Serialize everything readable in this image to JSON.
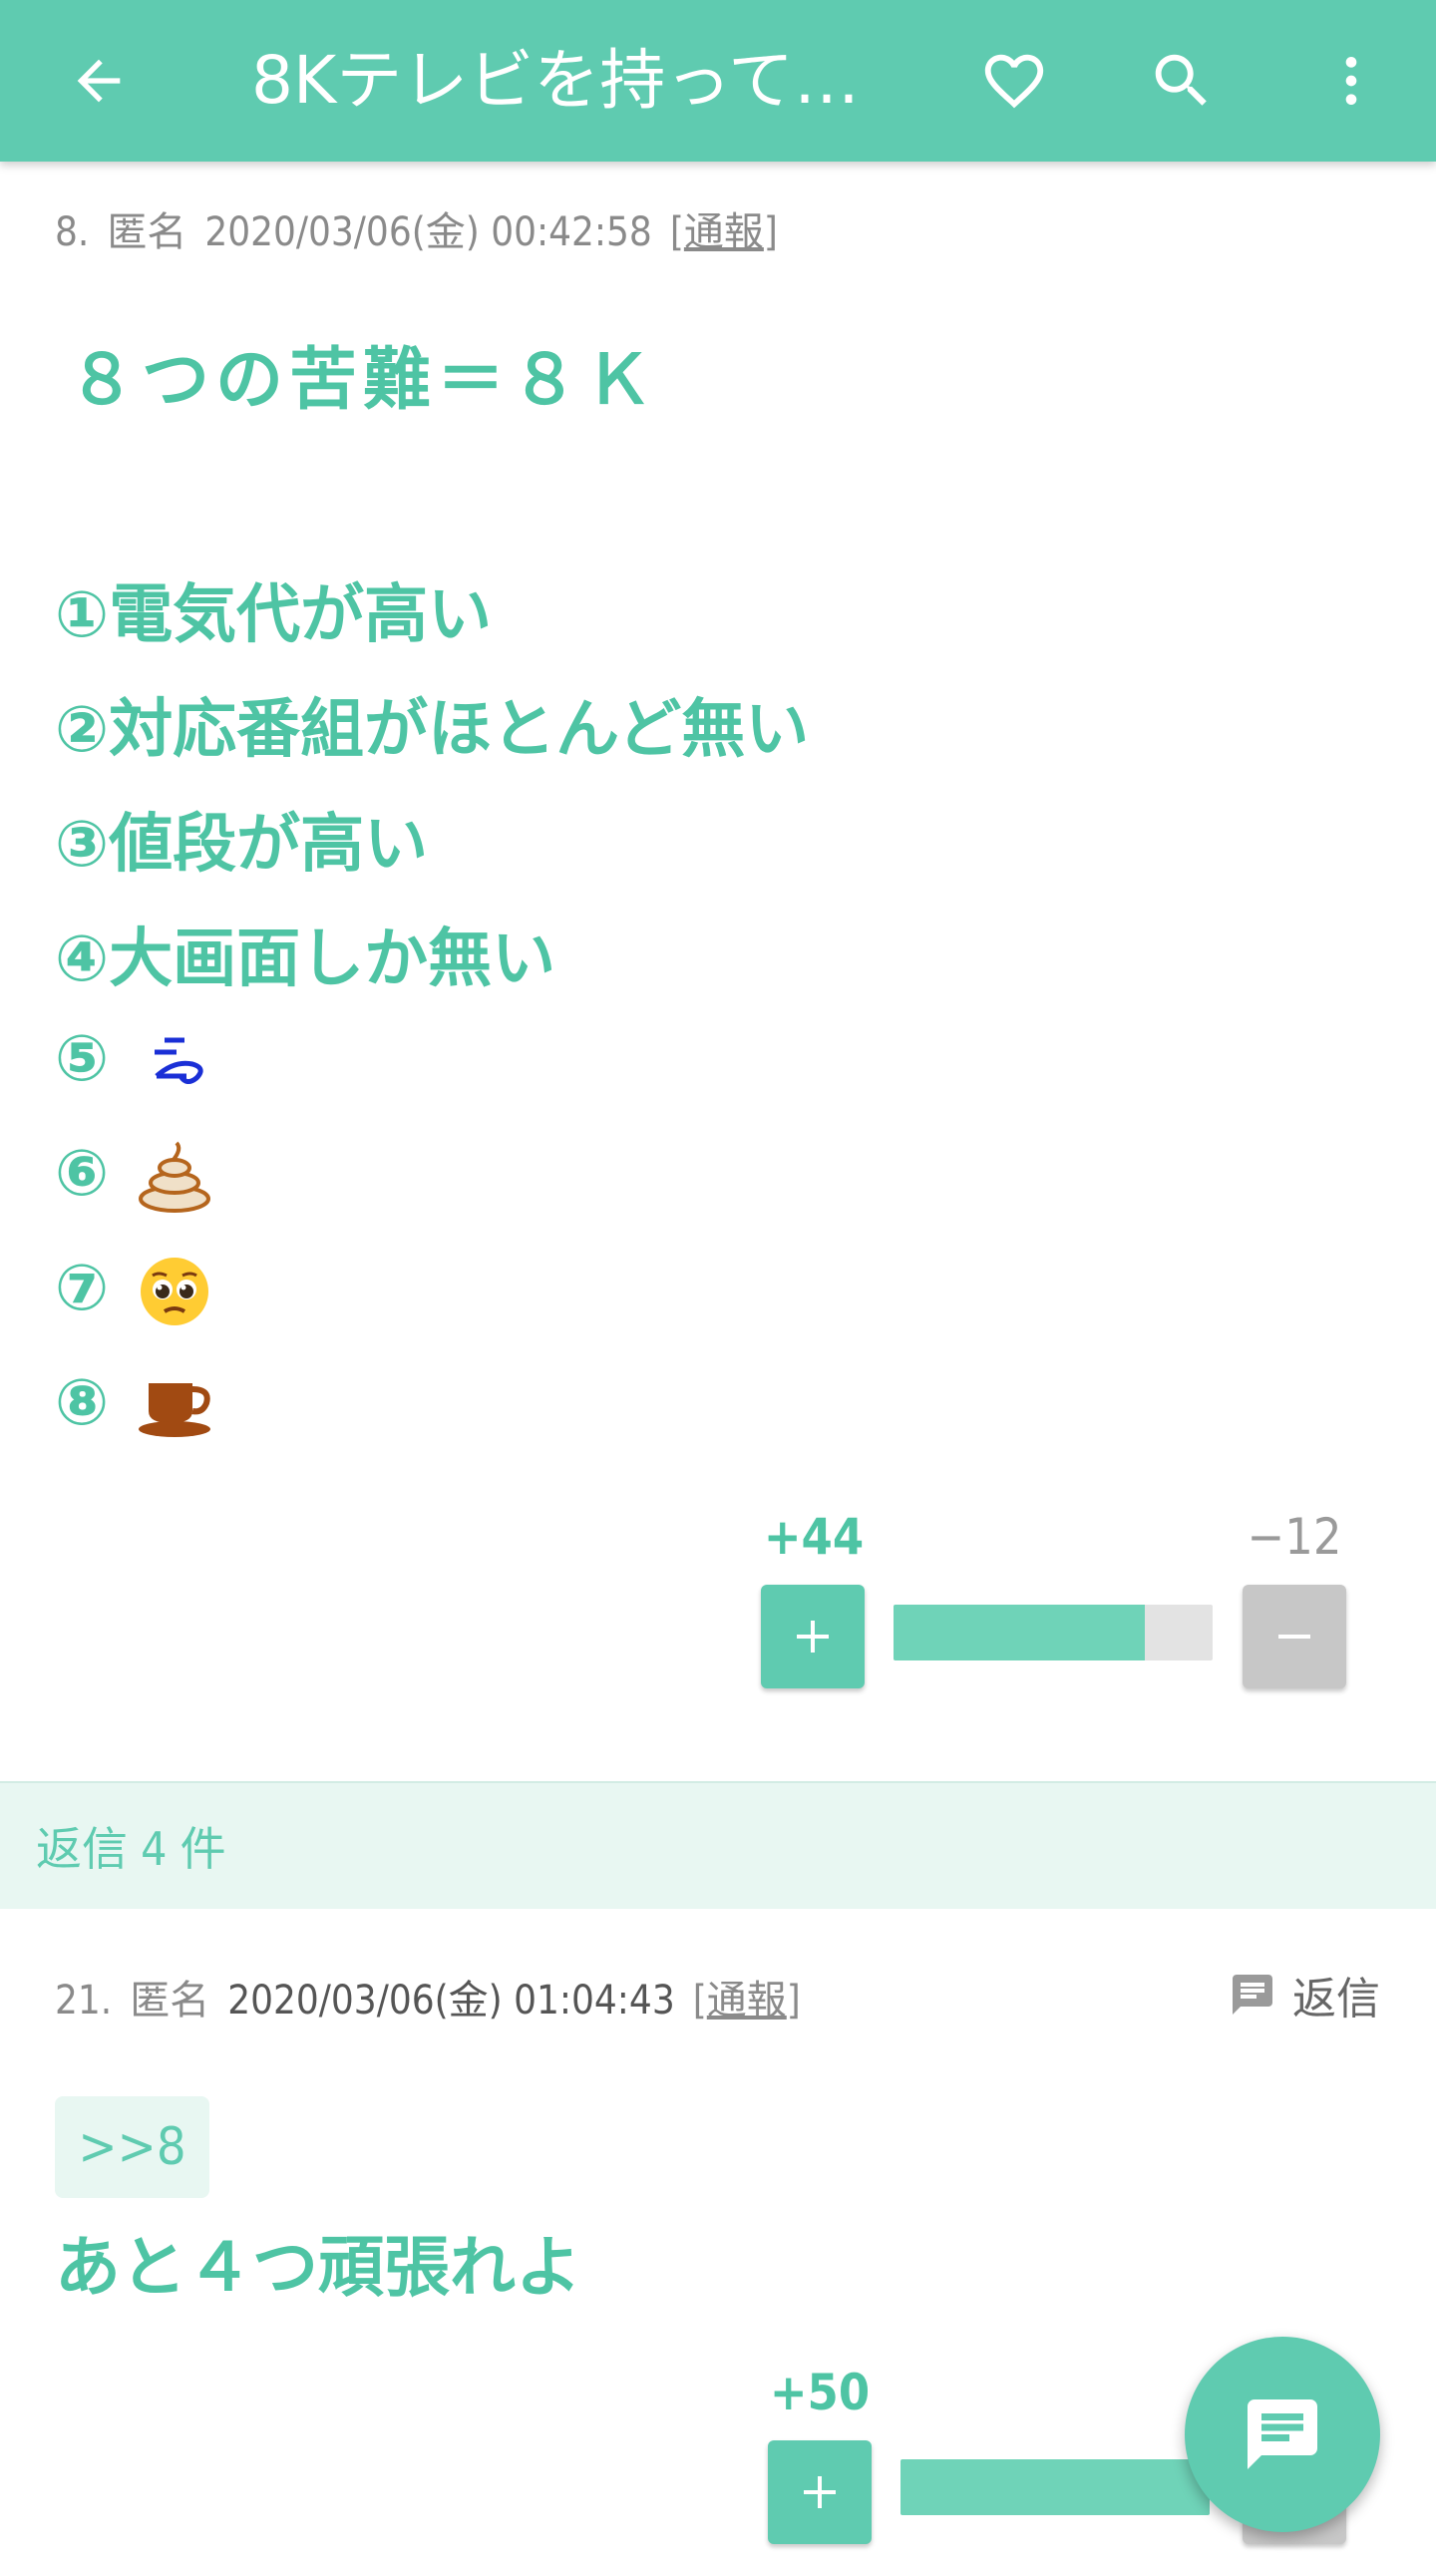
{
  "header": {
    "title": "8Kテレビを持って…",
    "back_icon": "arrow-left-icon",
    "favorite_icon": "heart-outline-icon",
    "search_icon": "search-icon",
    "more_icon": "more-vertical-icon"
  },
  "post1": {
    "number": "8.",
    "author": "匿名",
    "datetime": "2020/03/06(金) 00:42:58",
    "report_open": "[",
    "report": "通報",
    "report_close": "]",
    "title": "８つの苦難＝８Ｋ",
    "lines": [
      "①電気代が高い",
      "②対応番組がほとんど無い",
      "③値段が高い",
      "④大画面しか無い",
      "⑤",
      "⑥",
      "⑦",
      "⑧"
    ],
    "emoji": [
      "dash-icon",
      "poop-icon",
      "pleading-face-icon",
      "coffee-cup-icon"
    ],
    "plus": "+44",
    "minus": "−12",
    "plus_ratio": 0.786
  },
  "replies": {
    "label": "返信 4 件"
  },
  "post2": {
    "number": "21.",
    "author": "匿名",
    "datetime": "2020/03/06(金) 01:04:43",
    "report_open": "[",
    "report": "通報",
    "report_close": "]",
    "reply_label": "返信",
    "anchor": ">>8",
    "body": "あと４つ頑張れよ",
    "plus": "+50",
    "plus_ratio": 1.0
  },
  "fab": {
    "icon": "comment-icon"
  },
  "colors": {
    "accent": "#5fcbb0",
    "text_accent": "#4ec4a4",
    "meta": "#8a8a8a",
    "replies_bg": "#e8f7f2"
  }
}
